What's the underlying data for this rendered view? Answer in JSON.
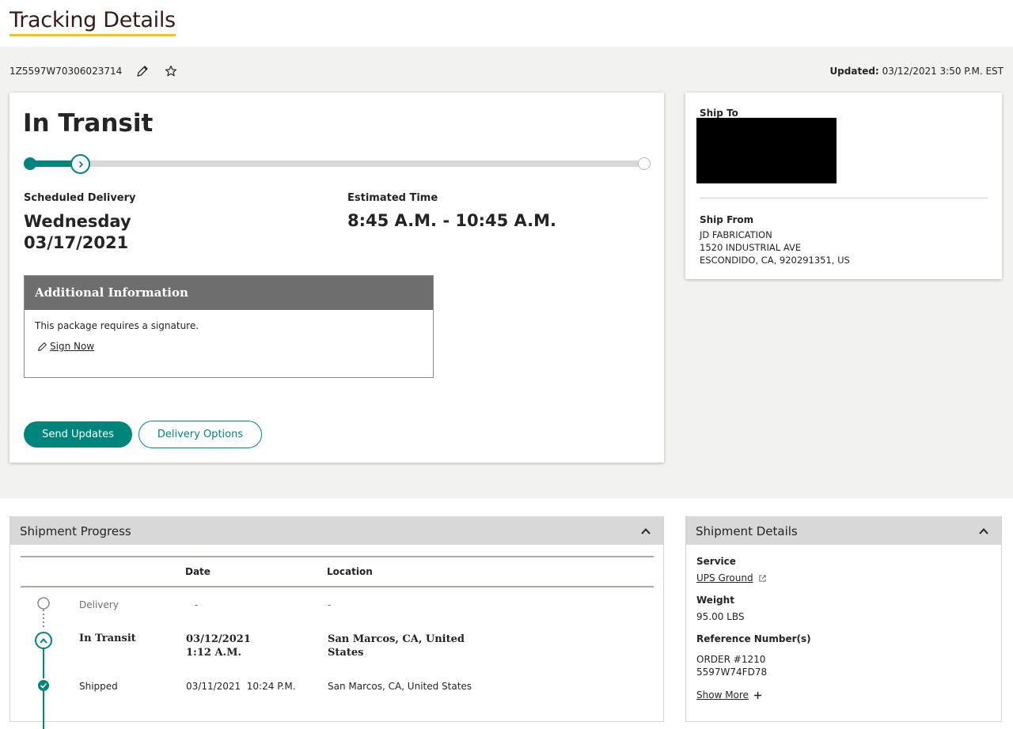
{
  "header": {
    "title": "Tracking Details"
  },
  "tracking": {
    "number": "1Z5597W70306023714",
    "edit_icon": "pencil-icon",
    "favorite_icon": "star-icon",
    "updated_label": "Updated:",
    "updated_value": "03/12/2021 3:50 P.M. EST"
  },
  "status": {
    "title": "In Transit",
    "progress_fraction": 0.09,
    "scheduled_label": "Scheduled Delivery",
    "scheduled_day": "Wednesday",
    "scheduled_date": "03/17/2021",
    "estimated_label": "Estimated Time",
    "estimated_value": "8:45 A.M. - 10:45 A.M.",
    "additional": {
      "title": "Additional Information",
      "text": "This package requires a signature.",
      "sign_label": "Sign Now"
    },
    "buttons": {
      "send_updates": "Send Updates",
      "delivery_options": "Delivery Options"
    }
  },
  "address": {
    "ship_to_label": "Ship To",
    "ship_from_label": "Ship From",
    "ship_from_lines": [
      "JD FABRICATION",
      "1520 INDUSTRIAL AVE",
      "ESCONDIDO, CA, 920291351, US"
    ]
  },
  "shipment_progress": {
    "title": "Shipment Progress",
    "columns": {
      "date": "Date",
      "location": "Location"
    },
    "rows": [
      {
        "status": "Delivery",
        "date": "-",
        "location": "-"
      },
      {
        "status": "In Transit",
        "date_line1": "03/12/2021",
        "date_line2": "1:12 A.M.",
        "location_line1": "San Marcos, CA, United",
        "location_line2": "States"
      },
      {
        "status": "Shipped",
        "date": "03/11/2021  10:24 P.M.",
        "location": "San Marcos, CA, United States"
      }
    ]
  },
  "shipment_details": {
    "title": "Shipment Details",
    "service_label": "Service",
    "service_value": "UPS Ground",
    "weight_label": "Weight",
    "weight_value": "95.00 LBS",
    "reference_label": "Reference Number(s)",
    "reference_values": [
      "ORDER #1210",
      "5597W74FD78"
    ],
    "show_more": "Show More"
  },
  "colors": {
    "accent": "#00857d",
    "title_underline": "#ffc400",
    "title_color": "#351c15"
  }
}
